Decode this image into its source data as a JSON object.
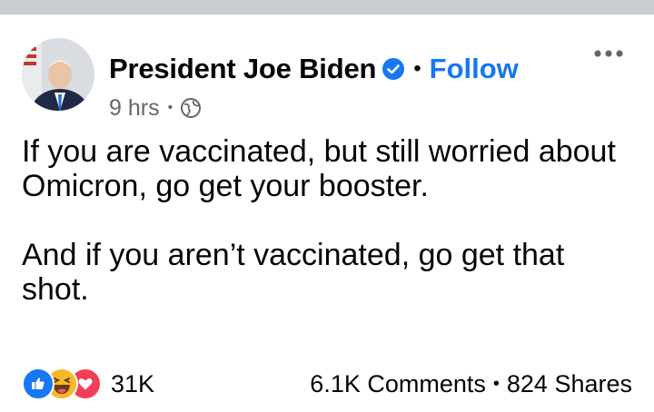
{
  "post": {
    "author": "President Joe Biden",
    "separator": "•",
    "follow_label": "Follow",
    "time": "9 hrs",
    "meta_separator": "•",
    "privacy_icon": "globe-icon",
    "more_icon": "more-options-icon",
    "verified_icon": "verified-badge-icon",
    "paragraphs": [
      "If you are vaccinated, but still worried about Omicron, go get your booster.",
      "And if you aren’t vaccinated, go get that shot."
    ]
  },
  "footer": {
    "reaction_icons": [
      "like-icon",
      "haha-icon",
      "love-icon"
    ],
    "reaction_count": "31K",
    "comments": "6.1K Comments",
    "dot": "•",
    "shares": "824 Shares"
  },
  "colors": {
    "link": "#1877f2",
    "meta": "#65676b",
    "text": "#050505",
    "like": "#1877f2",
    "love": "#f33e58",
    "haha": "#f7b928"
  }
}
